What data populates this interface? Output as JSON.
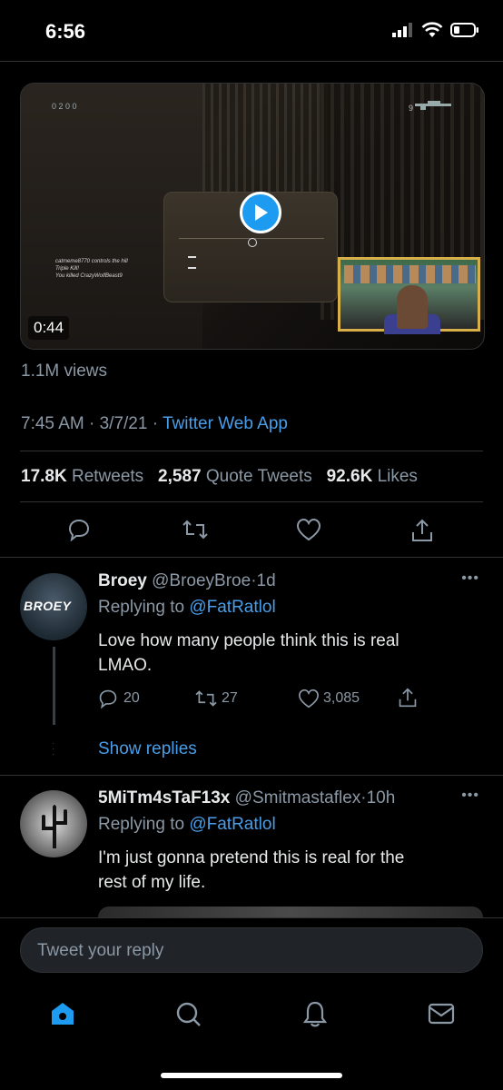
{
  "status_bar": {
    "time": "6:56"
  },
  "video": {
    "duration": "0:44",
    "hud_top": "0 2 0 0",
    "hud_right": "9",
    "killfeed": [
      "catmeme8770 controls the hill",
      "Triple Kill!",
      "You killed CrazyWolfBeast9"
    ]
  },
  "tweet": {
    "views": "1.1M views",
    "time": "7:45 AM",
    "date": "3/7/21",
    "sep": "·",
    "source": "Twitter Web App",
    "retweets_count": "17.8K",
    "retweets_label": "Retweets",
    "quotes_count": "2,587",
    "quotes_label": "Quote Tweets",
    "likes_count": "92.6K",
    "likes_label": "Likes"
  },
  "replies": [
    {
      "name": "Broey",
      "handle": "@BroeyBroe",
      "time": "1d",
      "avatar_text": "BROEY",
      "replying_to_label": "Replying to",
      "replying_to": "@FatRatlol",
      "text_line1": "Love how many people think this is real",
      "text_line2": "LMAO.",
      "reply_count": "20",
      "retweet_count": "27",
      "like_count": "3,085",
      "show_replies": "Show replies"
    },
    {
      "name": "5MiTm4sTaF13x",
      "handle": "@Smitmastaflex",
      "time": "10h",
      "replying_to_label": "Replying to",
      "replying_to": "@FatRatlol",
      "text_line1": "I'm just gonna pretend this is real for the",
      "text_line2": "rest of my life."
    }
  ],
  "compose": {
    "placeholder": "Tweet your reply"
  },
  "colors": {
    "accent": "#1d9bf0",
    "link": "#4a9ee8",
    "muted": "#8b98a5",
    "background": "#000000"
  }
}
